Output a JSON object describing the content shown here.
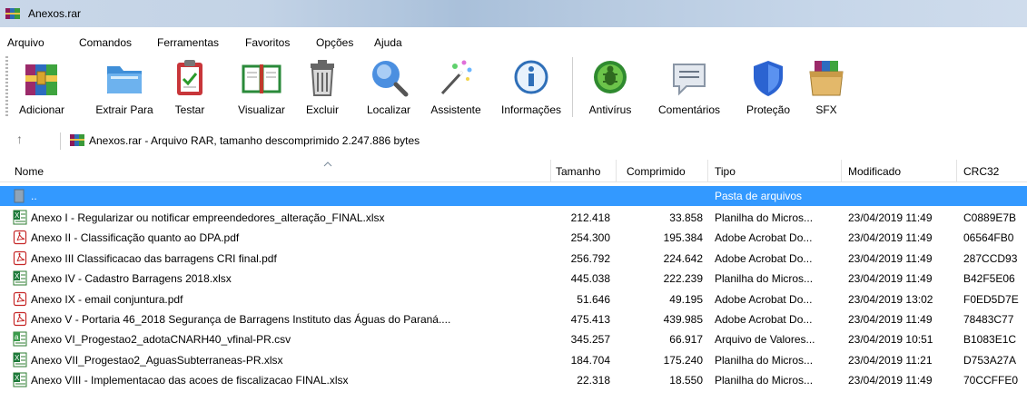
{
  "window": {
    "title": "Anexos.rar"
  },
  "menu": [
    "Arquivo",
    "Comandos",
    "Ferramentas",
    "Favoritos",
    "Opções",
    "Ajuda"
  ],
  "toolbar": [
    {
      "label": "Adicionar",
      "icon": "archive-books-icon"
    },
    {
      "label": "Extrair Para",
      "icon": "folder-extract-icon"
    },
    {
      "label": "Testar",
      "icon": "clipboard-check-icon"
    },
    {
      "label": "Visualizar",
      "icon": "open-book-icon"
    },
    {
      "label": "Excluir",
      "icon": "trash-icon"
    },
    {
      "label": "Localizar",
      "icon": "magnifier-icon"
    },
    {
      "label": "Assistente",
      "icon": "magic-wand-icon"
    },
    {
      "label": "Informações",
      "icon": "info-icon"
    },
    {
      "label": "Antivírus",
      "icon": "bug-icon"
    },
    {
      "label": "Comentários",
      "icon": "comment-icon"
    },
    {
      "label": "Proteção",
      "icon": "shield-icon"
    },
    {
      "label": "SFX",
      "icon": "sfx-box-icon"
    }
  ],
  "address": {
    "text": "Anexos.rar - Arquivo RAR, tamanho descomprimido 2.247.886 bytes"
  },
  "columns": {
    "name": "Nome",
    "size": "Tamanho",
    "packed": "Comprimido",
    "type": "Tipo",
    "modified": "Modificado",
    "crc": "CRC32"
  },
  "parent_row": {
    "name": "..",
    "type": "Pasta de arquivos"
  },
  "files": [
    {
      "name": "Anexo I - Regularizar ou notificar empreendedores_alteração_FINAL.xlsx",
      "size": "212.418",
      "packed": "33.858",
      "type": "Planilha do Micros...",
      "modified": "23/04/2019 11:49",
      "crc": "C0889E7B",
      "kind": "xlsx"
    },
    {
      "name": "Anexo II - Classificação  quanto ao DPA.pdf",
      "size": "254.300",
      "packed": "195.384",
      "type": "Adobe Acrobat Do...",
      "modified": "23/04/2019 11:49",
      "crc": "06564FB0",
      "kind": "pdf"
    },
    {
      "name": "Anexo III Classificacao das barragens CRI final.pdf",
      "size": "256.792",
      "packed": "224.642",
      "type": "Adobe Acrobat Do...",
      "modified": "23/04/2019 11:49",
      "crc": "287CCD93",
      "kind": "pdf"
    },
    {
      "name": "Anexo IV - Cadastro Barragens 2018.xlsx",
      "size": "445.038",
      "packed": "222.239",
      "type": "Planilha do Micros...",
      "modified": "23/04/2019 11:49",
      "crc": "B42F5E06",
      "kind": "xlsx"
    },
    {
      "name": "Anexo IX - email conjuntura.pdf",
      "size": "51.646",
      "packed": "49.195",
      "type": "Adobe Acrobat Do...",
      "modified": "23/04/2019 13:02",
      "crc": "F0ED5D7E",
      "kind": "pdf"
    },
    {
      "name": "Anexo V - Portaria 46_2018 Segurança de Barragens Instituto das Águas do Paraná....",
      "size": "475.413",
      "packed": "439.985",
      "type": "Adobe Acrobat Do...",
      "modified": "23/04/2019 11:49",
      "crc": "78483C77",
      "kind": "pdf"
    },
    {
      "name": "Anexo VI_Progestao2_adotaCNARH40_vfinal-PR.csv",
      "size": "345.257",
      "packed": "66.917",
      "type": "Arquivo de Valores...",
      "modified": "23/04/2019 10:51",
      "crc": "B1083E1C",
      "kind": "csv"
    },
    {
      "name": "Anexo VII_Progestao2_AguasSubterraneas-PR.xlsx",
      "size": "184.704",
      "packed": "175.240",
      "type": "Planilha do Micros...",
      "modified": "23/04/2019 11:21",
      "crc": "D753A27A",
      "kind": "xlsx"
    },
    {
      "name": "Anexo VIII - Implementacao das acoes de fiscalizacao FINAL.xlsx",
      "size": "22.318",
      "packed": "18.550",
      "type": "Planilha do Micros...",
      "modified": "23/04/2019 11:49",
      "crc": "70CCFFE0",
      "kind": "xlsx"
    }
  ]
}
